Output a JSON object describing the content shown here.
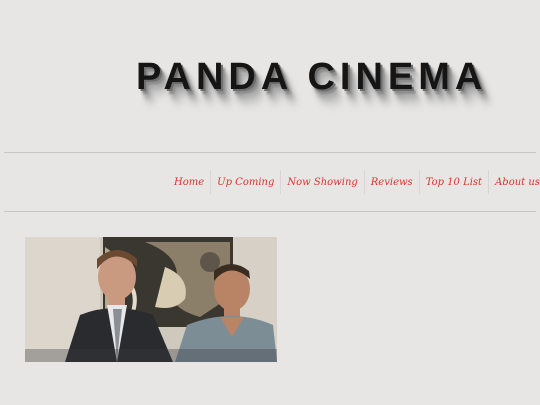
{
  "site": {
    "title": "PANDA CINEMA"
  },
  "nav": {
    "items": [
      {
        "label": "Home"
      },
      {
        "label": "Up Coming"
      },
      {
        "label": "Now Showing"
      },
      {
        "label": "Reviews"
      },
      {
        "label": "Top 10 List"
      },
      {
        "label": "About us"
      }
    ]
  },
  "hero": {
    "image_name": "movie-still"
  },
  "colors": {
    "background": "#e8e6e4",
    "nav_link": "#d9342b",
    "title": "#151515"
  }
}
